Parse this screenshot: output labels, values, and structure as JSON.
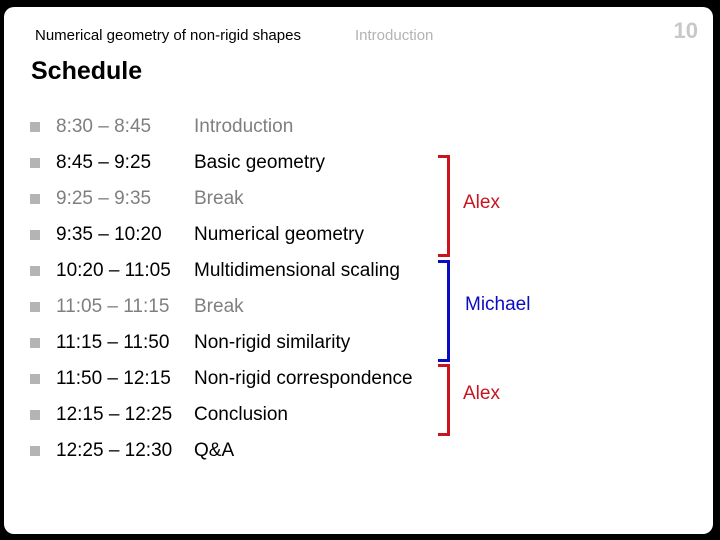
{
  "header": {
    "course_title": "Numerical geometry of non-rigid shapes",
    "section": "Introduction",
    "slide_number": "10"
  },
  "slide_title": "Schedule",
  "schedule": [
    {
      "time": "8:30 – 8:45",
      "topic": "Introduction",
      "state": "dim"
    },
    {
      "time": "8:45 – 9:25",
      "topic": "Basic geometry",
      "state": "active"
    },
    {
      "time": "9:25 – 9:35",
      "topic": "Break",
      "state": "dim"
    },
    {
      "time": "9:35 – 10:20",
      "topic": "Numerical geometry",
      "state": "active"
    },
    {
      "time": "10:20 – 11:05",
      "topic": "Multidimensional scaling",
      "state": "active"
    },
    {
      "time": "11:05 – 11:15",
      "topic": "Break",
      "state": "dim"
    },
    {
      "time": "11:15 – 11:50",
      "topic": "Non-rigid similarity",
      "state": "active"
    },
    {
      "time": "11:50 – 12:15",
      "topic": "Non-rigid correspondence",
      "state": "active"
    },
    {
      "time": "12:15 – 12:25",
      "topic": "Conclusion",
      "state": "active"
    },
    {
      "time": "12:25 – 12:30",
      "topic": "Q&A",
      "state": "active"
    }
  ],
  "presenters": [
    {
      "name": "Alex",
      "color": "#c8141e",
      "rows": "2–4"
    },
    {
      "name": "Michael",
      "color": "#0a0ac0",
      "rows": "5–7"
    },
    {
      "name": "Alex",
      "color": "#c8141e",
      "rows": "8–9"
    }
  ],
  "colors": {
    "active_text": "#000000",
    "dim_text": "#7f7f7f",
    "bullet": "#b4b4b4",
    "presenter_red": "#c8141e",
    "presenter_blue": "#0a0ac0"
  }
}
